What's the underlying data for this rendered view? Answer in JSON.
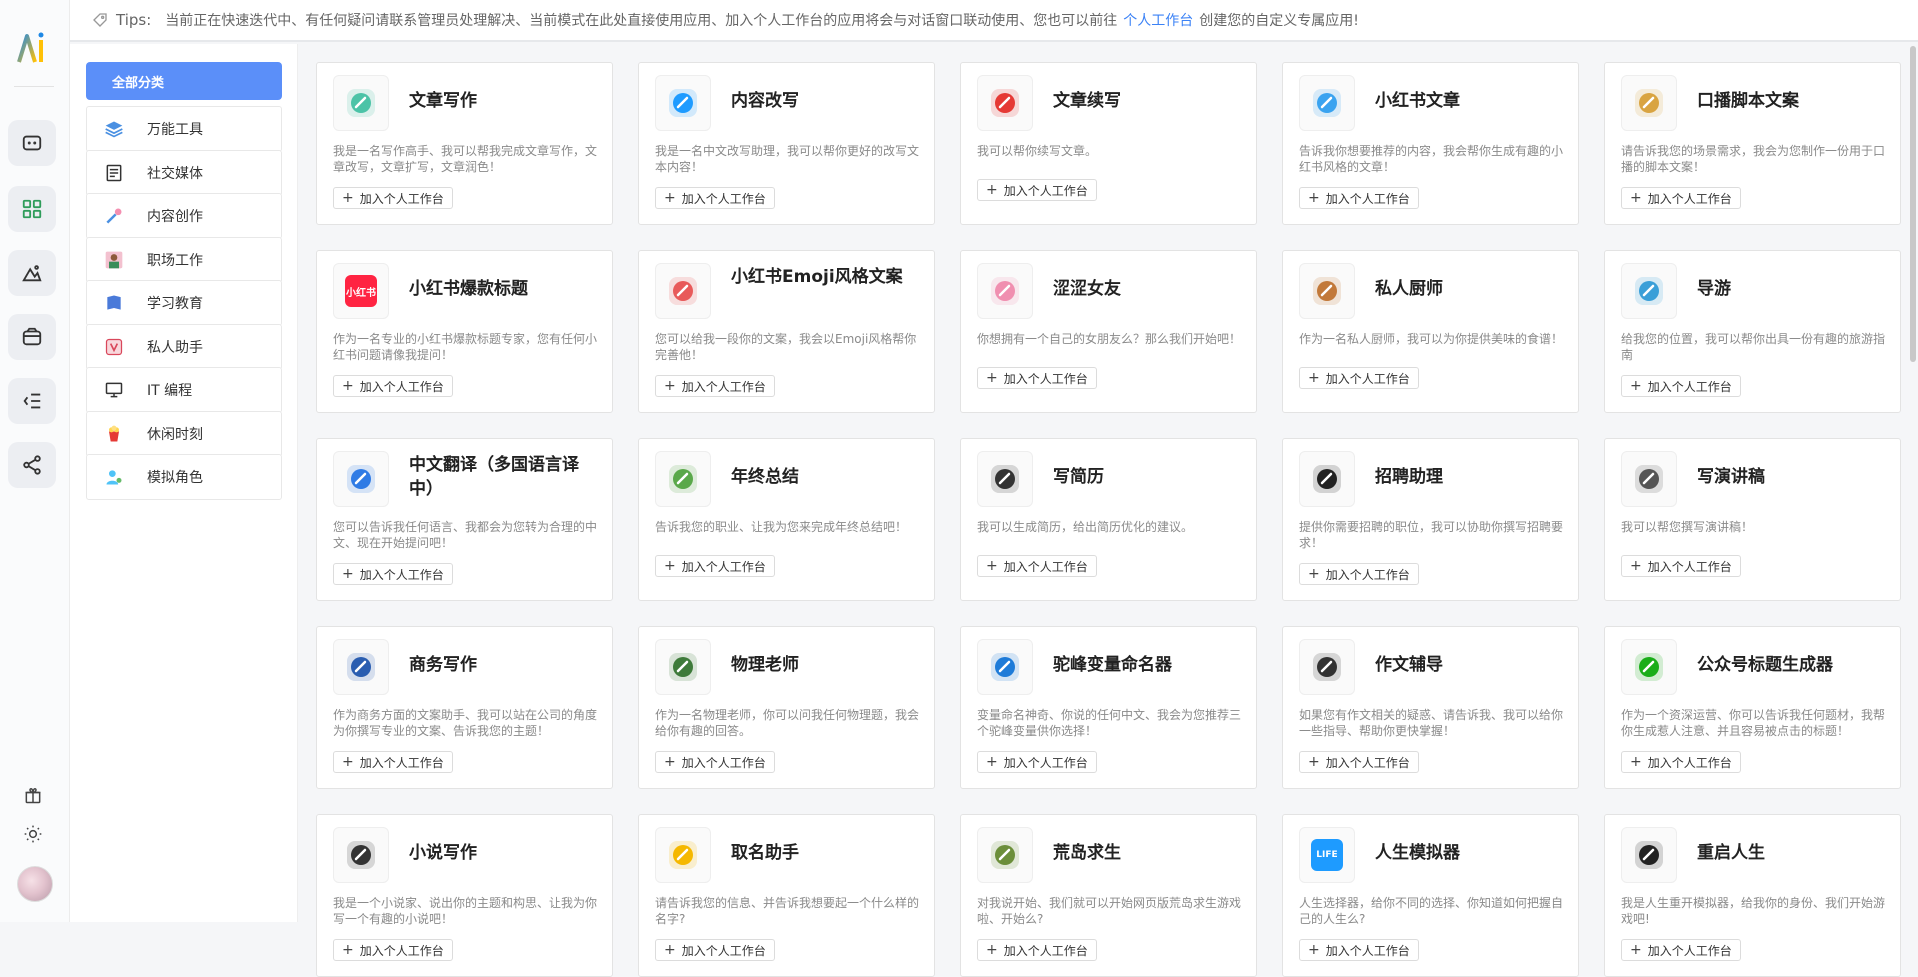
{
  "tips": {
    "label": "Tips:",
    "text_before": "当前正在快速迭代中、有任何疑问请联系管理员处理解决、当前模式在此处直接使用应用、加入个人工作台的应用将会与对话窗口联动使用、您也可以前往",
    "link": "个人工作台",
    "text_after": "创建您的自定义专属应用!"
  },
  "rail": {
    "logo": "AI",
    "icons": [
      "chat-icon",
      "apps-grid-icon",
      "image-mountain-icon",
      "wallet-icon",
      "menu-list-icon",
      "share-icon"
    ],
    "bottom_icons": [
      "gift-icon",
      "sun-icon",
      "avatar"
    ]
  },
  "sidebar": {
    "all_label": "全部分类",
    "items": [
      {
        "label": "万能工具",
        "icon": "layers-icon"
      },
      {
        "label": "社交媒体",
        "icon": "document-icon"
      },
      {
        "label": "内容创作",
        "icon": "pen-brush-icon"
      },
      {
        "label": "职场工作",
        "icon": "person-icon"
      },
      {
        "label": "学习教育",
        "icon": "book-icon"
      },
      {
        "label": "私人助手",
        "icon": "assistant-icon"
      },
      {
        "label": "IT 编程",
        "icon": "computer-icon"
      },
      {
        "label": "休闲时刻",
        "icon": "popcorn-icon"
      },
      {
        "label": "模拟角色",
        "icon": "role-icon"
      }
    ]
  },
  "add_label": "加入个人工作台",
  "apps": [
    {
      "title": "文章写作",
      "desc": "我是一名写作高手、我可以帮我完成文章写作，文章改写，文章扩写，文章润色！",
      "icon": "article-writing-icon",
      "color": "#4cc3a7"
    },
    {
      "title": "内容改写",
      "desc": "我是一名中文改写助理，我可以帮你更好的改写文本内容！",
      "icon": "pen-rewrite-icon",
      "color": "#1e9bff"
    },
    {
      "title": "文章续写",
      "desc": "我可以帮你续写文章。",
      "icon": "article-continue-icon",
      "color": "#e53935"
    },
    {
      "title": "小红书文章",
      "desc": "告诉我你想要推荐的内容，我会帮你生成有趣的小红书风格的文章！",
      "icon": "xhs-article-icon",
      "color": "#3aa3f0"
    },
    {
      "title": "口播脚本文案",
      "desc": "请告诉我您的场景需求，我会为您制作一份用于口播的脚本文案！",
      "icon": "script-icon",
      "color": "#d9a441"
    },
    {
      "title": "小红书爆款标题",
      "desc": "作为一名专业的小红书爆款标题专家，您有任何小红书问题请像我提问！",
      "icon": "xiaohongshu-icon",
      "color": "#ff2442",
      "icon_text": "小红书"
    },
    {
      "title": "小红书Emoji风格文案",
      "desc": "您可以给我一段你的文案，我会以Emoji风格帮你完善他！",
      "icon": "girl-avatar-icon",
      "color": "#e85a5a"
    },
    {
      "title": "涩涩女友",
      "desc": "你想拥有一个自己的女朋友么？那么我们开始吧！",
      "icon": "girlfriend-icon",
      "color": "#f08fb0"
    },
    {
      "title": "私人厨师",
      "desc": "作为一名私人厨师，我可以为你提供美味的食谱！",
      "icon": "chef-icon",
      "color": "#c2793a"
    },
    {
      "title": "导游",
      "desc": "给我您的位置，我可以帮你出具一份有趣的旅游指南",
      "icon": "globe-icon",
      "color": "#3a9fd8"
    },
    {
      "title": "中文翻译（多国语言译中）",
      "desc": "您可以告诉我任何语言、我都会为您转为合理的中文、现在开始提问吧！",
      "icon": "translate-icon",
      "color": "#2f7be5"
    },
    {
      "title": "年终总结",
      "desc": "告诉我您的职业、让我为您来完成年终总结吧！",
      "icon": "summary-icon",
      "color": "#5aa84a"
    },
    {
      "title": "写简历",
      "desc": "我可以生成简历，给出简历优化的建议。",
      "icon": "resume-icon",
      "color": "#333333"
    },
    {
      "title": "招聘助理",
      "desc": "提供你需要招聘的职位，我可以协助你撰写招聘要求！",
      "icon": "recruit-icon",
      "color": "#222222"
    },
    {
      "title": "写演讲稿",
      "desc": "我可以帮您撰写演讲稿！",
      "icon": "speech-icon",
      "color": "#555555"
    },
    {
      "title": "商务写作",
      "desc": "作为商务方面的文案助手、我可以站在公司的角度为你撰写专业的文案、告诉我您的主题！",
      "icon": "fountain-pen-icon",
      "color": "#2a5db0"
    },
    {
      "title": "物理老师",
      "desc": "作为一名物理老师，你可以问我任何物理题，我会给你有趣的回答。",
      "icon": "plant-icon",
      "color": "#3e7a3a"
    },
    {
      "title": "驼峰变量命名器",
      "desc": "变量命名神奇、你说的任何中文、我会为您推荐三个驼峰变量供你选择！",
      "icon": "variable-icon",
      "color": "#1e7bd8"
    },
    {
      "title": "作文辅导",
      "desc": "如果您有作文相关的疑惑、请告诉我、我可以给你一些指导、帮助你更快掌握！",
      "icon": "tutor-icon",
      "color": "#333333"
    },
    {
      "title": "公众号标题生成器",
      "desc": "作为一个资深运营、你可以告诉我任何题材，我帮你生成惹人注意、并且容易被点击的标题！",
      "icon": "wechat-icon",
      "color": "#1aad19"
    },
    {
      "title": "小说写作",
      "desc": "我是一个小说家、说出你的主题和构思、让我为你写一个有趣的小说吧！",
      "icon": "quill-icon",
      "color": "#333333"
    },
    {
      "title": "取名助手",
      "desc": "请告诉我您的信息、并告诉我想要起一个什么样的名字?",
      "icon": "naming-icon",
      "color": "#f5b800"
    },
    {
      "title": "荒岛求生",
      "desc": "对我说开始、我们就可以开始网页版荒岛求生游戏啦、开始么?",
      "icon": "island-icon",
      "color": "#6b8e3a"
    },
    {
      "title": "人生模拟器",
      "desc": "人生选择器，给你不同的选择、你知道如何把握自己的人生么?",
      "icon": "life-icon",
      "color": "#1e9bff",
      "icon_text": "LIFE"
    },
    {
      "title": "重启人生",
      "desc": "我是人生重开模拟器，给我你的身份、我们开始游戏吧!",
      "icon": "restart-icon",
      "color": "#222222"
    }
  ]
}
